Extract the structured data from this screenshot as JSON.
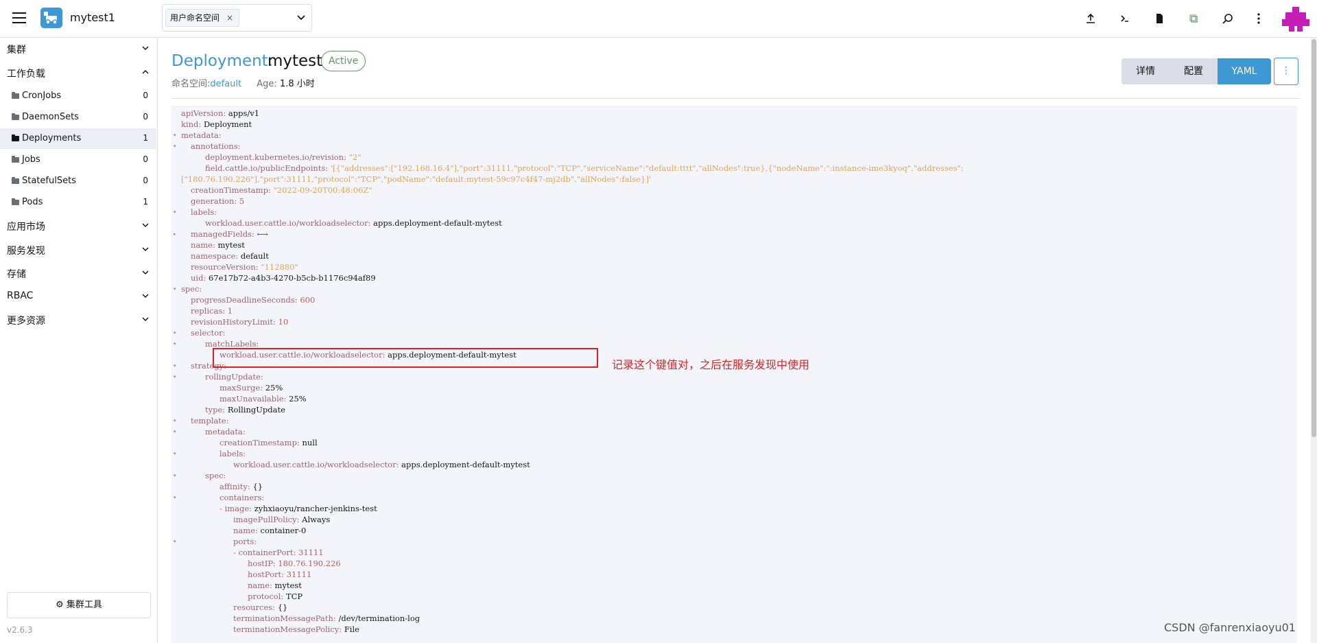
{
  "header": {
    "cluster_name": "mytest1",
    "namespace_tag": "用户命名空间",
    "namespace_tag_remove": "×",
    "icons": [
      "upload-icon",
      "terminal-icon",
      "file-icon",
      "copy-icon",
      "search-icon",
      "more-vertical-icon"
    ]
  },
  "sidebar": {
    "groups": [
      {
        "label": "集群",
        "expanded": false
      },
      {
        "label": "工作负载",
        "expanded": true
      },
      {
        "label": "应用市场",
        "expanded": false
      },
      {
        "label": "服务发现",
        "expanded": false
      },
      {
        "label": "存储",
        "expanded": false
      },
      {
        "label": "RBAC",
        "expanded": false
      },
      {
        "label": "更多资源",
        "expanded": false
      }
    ],
    "items": [
      {
        "label": "CronJobs",
        "count": "0"
      },
      {
        "label": "DaemonSets",
        "count": "0"
      },
      {
        "label": "Deployments",
        "count": "1",
        "active": true
      },
      {
        "label": "Jobs",
        "count": "0"
      },
      {
        "label": "StatefulSets",
        "count": "0"
      },
      {
        "label": "Pods",
        "count": "1"
      }
    ],
    "tools_button": "集群工具",
    "version": "v2.6.3"
  },
  "main": {
    "title_prefix": "Deployment:",
    "title_name": "mytest",
    "status": "Active",
    "namespace_label": "命名空间:",
    "namespace_value": "default",
    "age_label": "Age:",
    "age_value": "1.8 小时",
    "view_tabs": [
      "详情",
      "配置",
      "YAML"
    ],
    "active_tab": "YAML",
    "more_button": "⋮"
  },
  "yaml_lines": [
    {
      "k": "apiVersion",
      "v": "apps/v1",
      "t": "v"
    },
    {
      "k": "kind",
      "v": "Deployment",
      "t": "v"
    },
    {
      "k": "metadata",
      "v": "",
      "t": "v"
    },
    {
      "k": "annotations",
      "v": "",
      "t": "v"
    },
    {
      "k": "deployment.kubernetes.io/revision",
      "v": "\"2\"",
      "t": "s"
    },
    {
      "k": "field.cattle.io/publicEndpoints",
      "v": "'[{\"addresses\":[\"192.168.16.4\"],\"port\":31111,\"protocol\":\"TCP\",\"serviceName\":\"default:tttt\",\"allNodes\":true},{\"nodeName\":\":instance-ime3kyoq\",\"addresses\":",
      "t": "s"
    },
    {
      "k": "",
      "v": "[\"180.76.190.226\"],\"port\":31111,\"protocol\":\"TCP\",\"podName\":\"default:mytest-59c97c4f47-mj2db\",\"allNodes\":false}]'",
      "t": "s"
    },
    {
      "k": "creationTimestamp",
      "v": "\"2022-09-20T00:48:06Z\"",
      "t": "s"
    },
    {
      "k": "generation",
      "v": "5",
      "t": "n"
    },
    {
      "k": "labels",
      "v": "",
      "t": "v"
    },
    {
      "k": "workload.user.cattle.io/workloadselector",
      "v": "apps.deployment-default-mytest",
      "t": "v"
    },
    {
      "k": "managedFields",
      "v": "⟷",
      "t": "ar"
    },
    {
      "k": "name",
      "v": "mytest",
      "t": "v"
    },
    {
      "k": "namespace",
      "v": "default",
      "t": "v"
    },
    {
      "k": "resourceVersion",
      "v": "\"112880\"",
      "t": "s"
    },
    {
      "k": "uid",
      "v": "67e17b72-a4b3-4270-b5cb-b1176c94af89",
      "t": "v"
    },
    {
      "k": "spec",
      "v": "",
      "t": "v"
    },
    {
      "k": "progressDeadlineSeconds",
      "v": "600",
      "t": "n"
    },
    {
      "k": "replicas",
      "v": "1",
      "t": "n"
    },
    {
      "k": "revisionHistoryLimit",
      "v": "10",
      "t": "n"
    },
    {
      "k": "selector",
      "v": "",
      "t": "v"
    },
    {
      "k": "matchLabels",
      "v": "",
      "t": "v"
    },
    {
      "k": "workload.user.cattle.io/workloadselector",
      "v": "apps.deployment-default-mytest",
      "t": "v"
    },
    {
      "k": "strategy",
      "v": "",
      "t": "v"
    },
    {
      "k": "rollingUpdate",
      "v": "",
      "t": "v"
    },
    {
      "k": "maxSurge",
      "v": "25%",
      "t": "v"
    },
    {
      "k": "maxUnavailable",
      "v": "25%",
      "t": "v"
    },
    {
      "k": "type",
      "v": "RollingUpdate",
      "t": "v"
    },
    {
      "k": "template",
      "v": "",
      "t": "v"
    },
    {
      "k": "metadata",
      "v": "",
      "t": "v"
    },
    {
      "k": "creationTimestamp",
      "v": "null",
      "t": "v"
    },
    {
      "k": "labels",
      "v": "",
      "t": "v"
    },
    {
      "k": "workload.user.cattle.io/workloadselector",
      "v": "apps.deployment-default-mytest",
      "t": "v"
    },
    {
      "k": "spec",
      "v": "",
      "t": "v"
    },
    {
      "k": "affinity",
      "v": "{}",
      "t": "v"
    },
    {
      "k": "containers",
      "v": "",
      "t": "v"
    },
    {
      "k": "- image",
      "v": "zyhxiaoyu/rancher-jenkins-test",
      "t": "v"
    },
    {
      "k": "imagePullPolicy",
      "v": "Always",
      "t": "v"
    },
    {
      "k": "name",
      "v": "container-0",
      "t": "v"
    },
    {
      "k": "ports",
      "v": "",
      "t": "v"
    },
    {
      "k": "- containerPort",
      "v": "31111",
      "t": "n"
    },
    {
      "k": "hostIP",
      "v": "180.76.190.226",
      "t": "n"
    },
    {
      "k": "hostPort",
      "v": "31111",
      "t": "n"
    },
    {
      "k": "name",
      "v": "mytest",
      "t": "v"
    },
    {
      "k": "protocol",
      "v": "TCP",
      "t": "v"
    },
    {
      "k": "resources",
      "v": "{}",
      "t": "v"
    },
    {
      "k": "terminationMessagePath",
      "v": "/dev/termination-log",
      "t": "v"
    },
    {
      "k": "terminationMessagePolicy",
      "v": "File",
      "t": "v"
    }
  ],
  "annotation_text": "记录这个键值对，之后在服务发现中使用",
  "watermark": "CSDN @fanrenxiaoyu01"
}
